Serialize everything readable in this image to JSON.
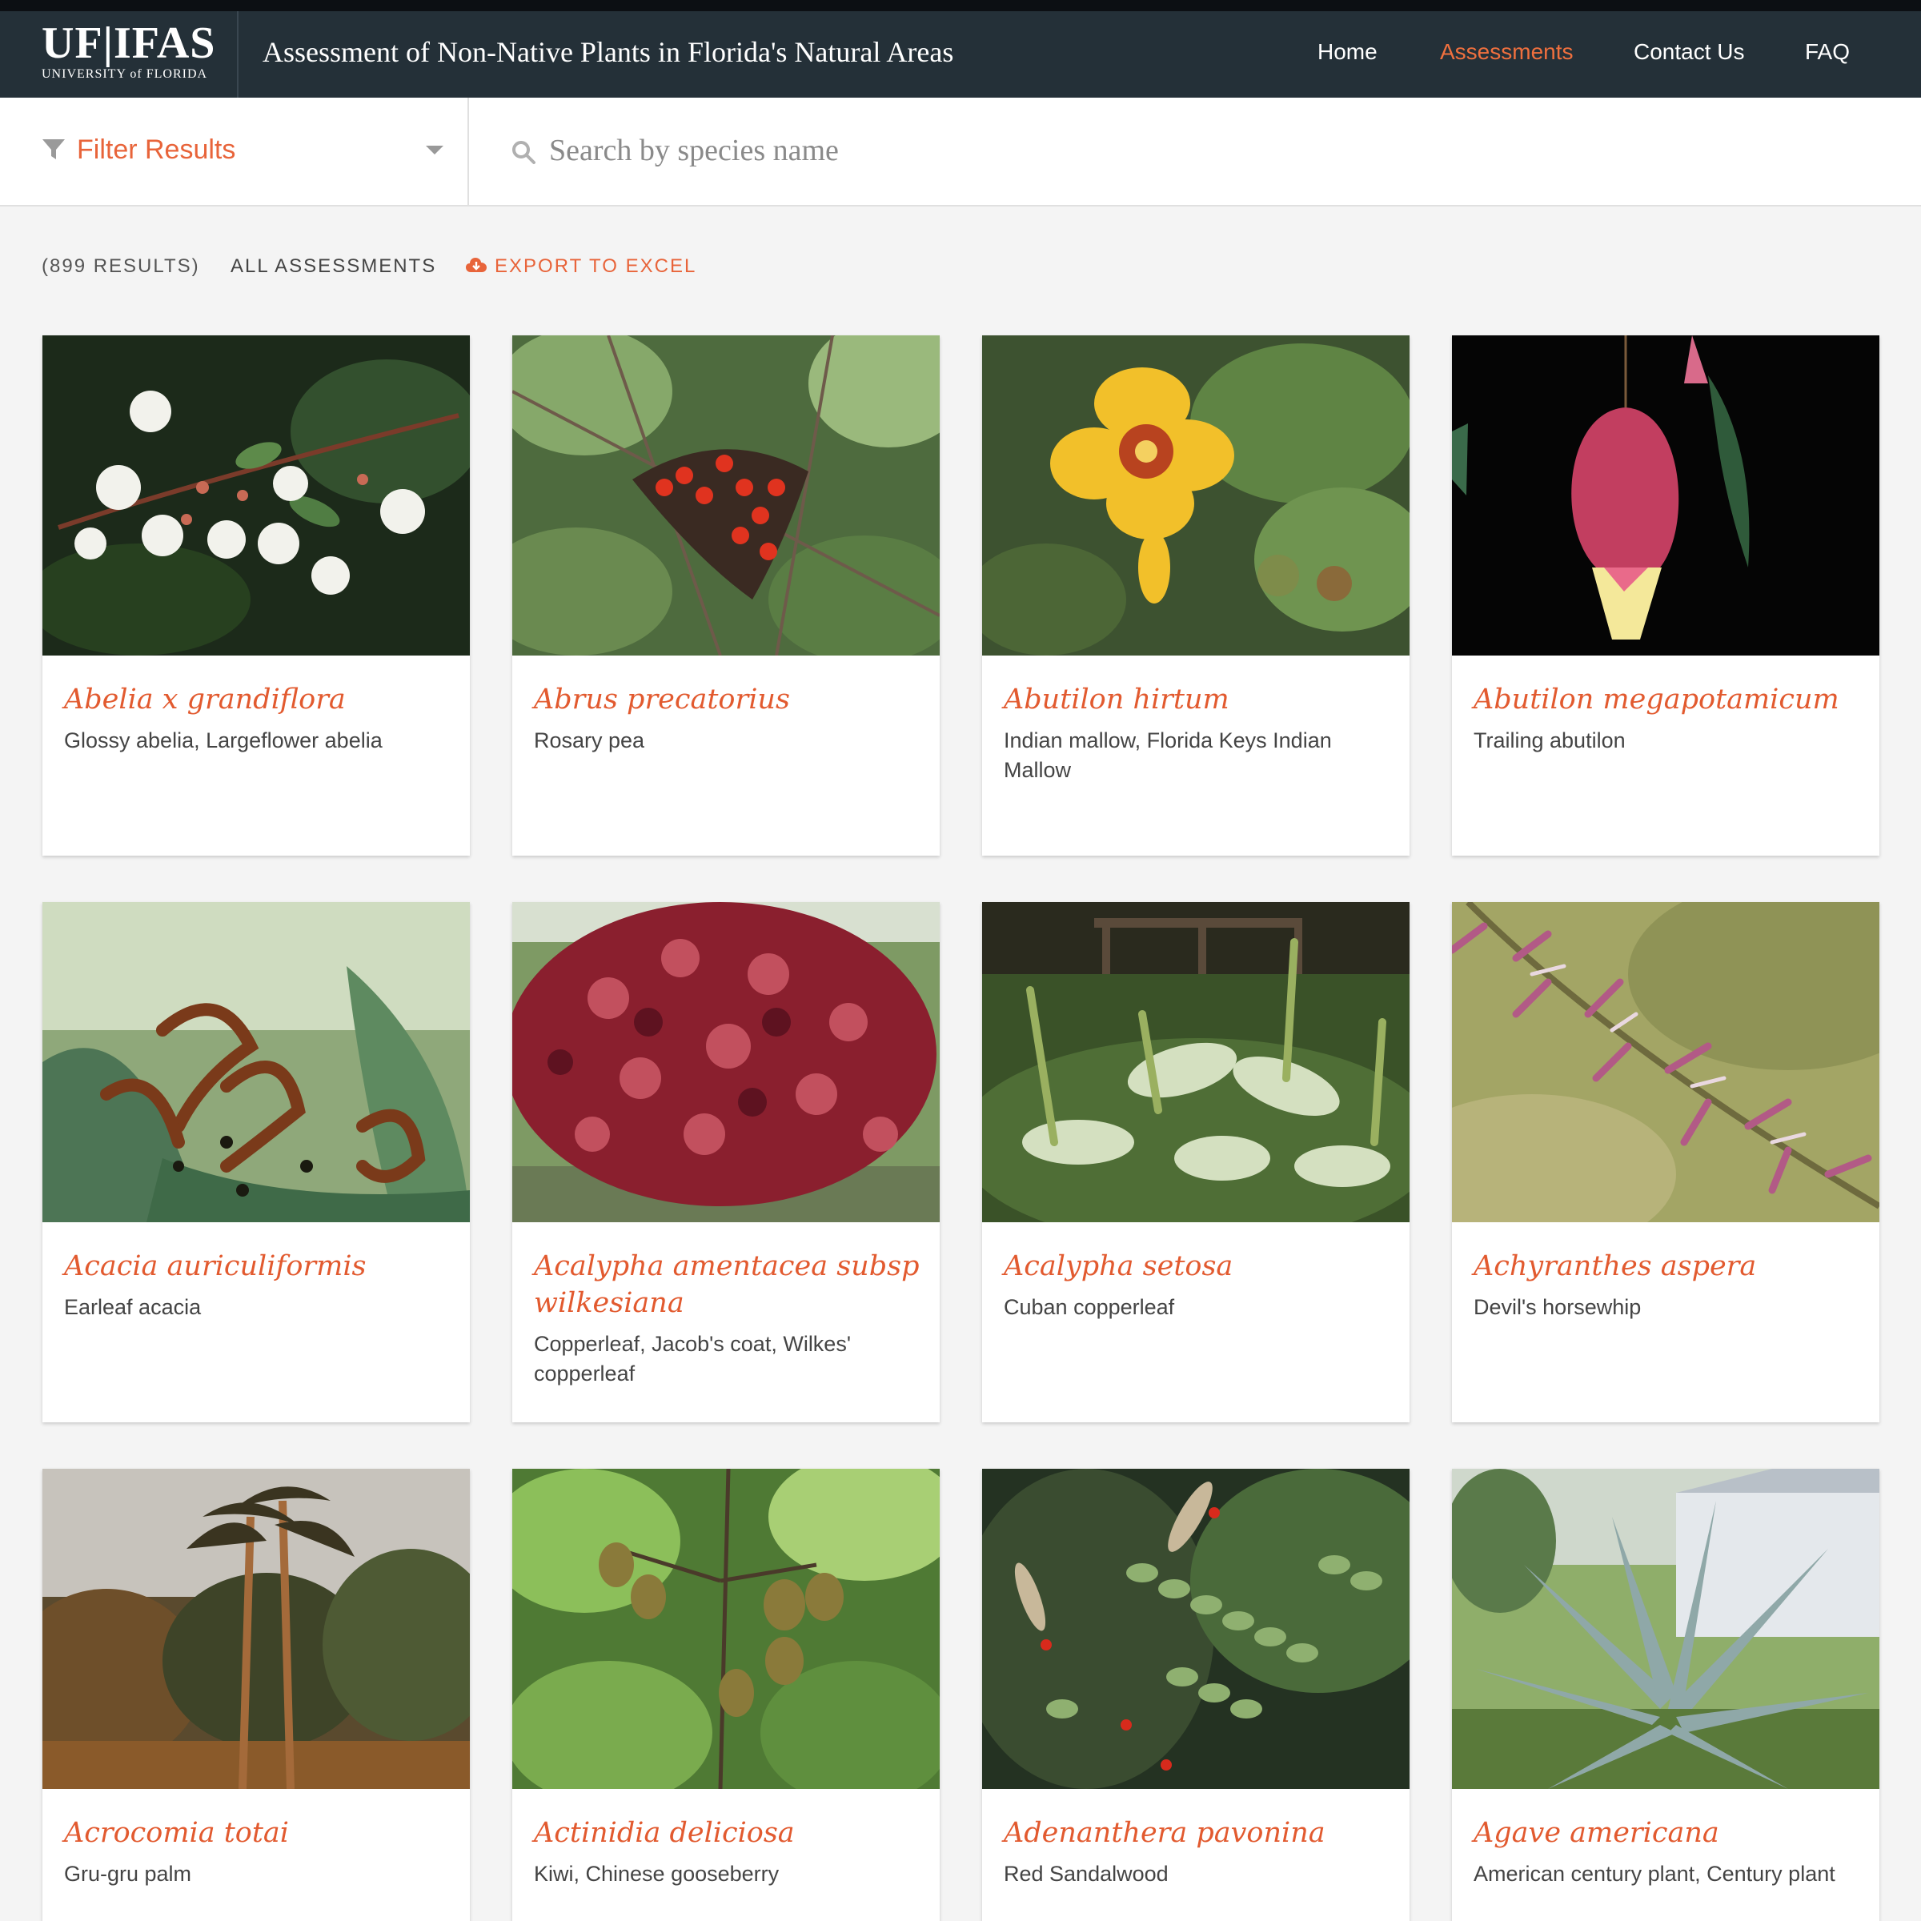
{
  "header": {
    "logo_main": "UF|IFAS",
    "logo_sub": "UNIVERSITY of FLORIDA",
    "title": "Assessment of Non-Native Plants in Florida's Natural Areas",
    "nav": [
      {
        "label": "Home",
        "active": false
      },
      {
        "label": "Assessments",
        "active": true
      },
      {
        "label": "Contact Us",
        "active": false
      },
      {
        "label": "FAQ",
        "active": false
      }
    ]
  },
  "filter": {
    "label": "Filter Results",
    "icon": "funnel-icon"
  },
  "search": {
    "placeholder": "Search by species name",
    "value": "",
    "icon": "search-icon"
  },
  "results": {
    "count": "(899 RESULTS)",
    "scope": "ALL ASSESSMENTS",
    "export_label": "EXPORT TO EXCEL",
    "export_icon": "cloud-download-icon"
  },
  "colors": {
    "accent": "#e8643a",
    "header_bg": "#243038",
    "species_name": "#e25a2f"
  },
  "cards": [
    {
      "scientific": "Abelia x grandiflora",
      "common": "Glossy abelia, Largeflower abelia"
    },
    {
      "scientific": "Abrus precatorius",
      "common": "Rosary pea"
    },
    {
      "scientific": "Abutilon hirtum",
      "common": "Indian mallow, Florida Keys Indian Mallow"
    },
    {
      "scientific": "Abutilon megapotamicum",
      "common": "Trailing abutilon"
    },
    {
      "scientific": "Acacia auriculiformis",
      "common": "Earleaf acacia"
    },
    {
      "scientific": "Acalypha amentacea subsp wilkesiana",
      "common": "Copperleaf, Jacob's coat, Wilkes' copperleaf"
    },
    {
      "scientific": "Acalypha setosa",
      "common": "Cuban copperleaf"
    },
    {
      "scientific": "Achyranthes aspera",
      "common": "Devil's horsewhip"
    },
    {
      "scientific": "Acrocomia totai",
      "common": "Gru-gru palm"
    },
    {
      "scientific": "Actinidia deliciosa",
      "common": "Kiwi, Chinese gooseberry"
    },
    {
      "scientific": "Adenanthera pavonina",
      "common": "Red Sandalwood"
    },
    {
      "scientific": "Agave americana",
      "common": "American century plant, Century plant"
    }
  ]
}
